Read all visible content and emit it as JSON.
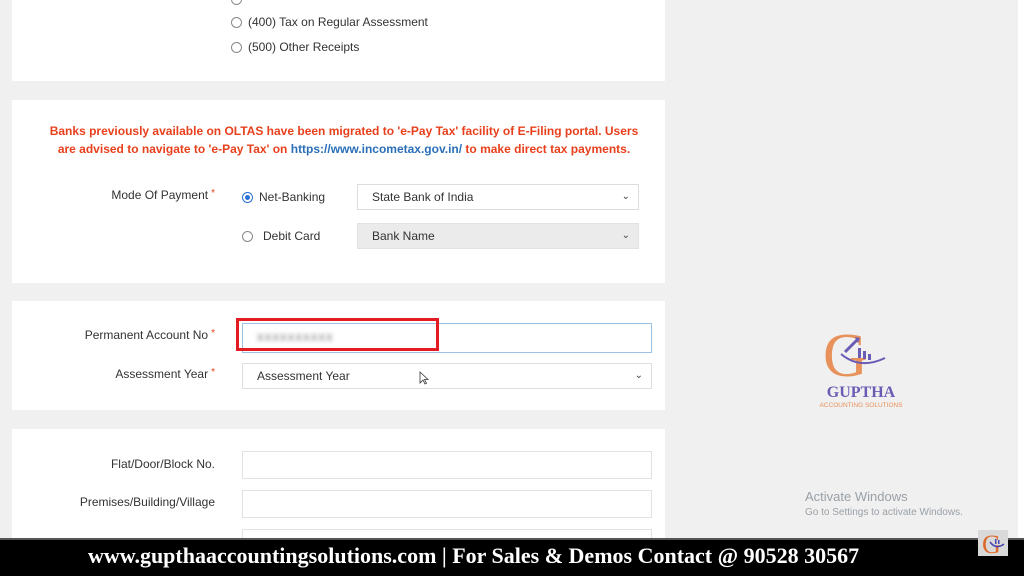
{
  "tax_type_options": [
    {
      "label": "(400) Tax on Regular Assessment",
      "selected": false
    },
    {
      "label": "(500) Other Receipts",
      "selected": false
    }
  ],
  "notice": {
    "text_before": "Banks previously available on OLTAS have been migrated to 'e-Pay Tax' facility of E-Filing portal. Users are advised to navigate to 'e-Pay Tax' on ",
    "link": "https://www.incometax.gov.in/",
    "text_after": " to make direct tax payments."
  },
  "payment": {
    "label": "Mode Of Payment",
    "required_mark": "*",
    "options": [
      {
        "label": "Net-Banking",
        "selected": true,
        "bank_value": "State Bank of India"
      },
      {
        "label": "Debit Card",
        "selected": false,
        "bank_value": "Bank Name"
      }
    ]
  },
  "identity": {
    "pan_label": "Permanent Account No",
    "pan_value": "XXXXXXXXXX",
    "assessment_year_label": "Assessment Year",
    "assessment_year_value": "Assessment Year",
    "required_mark": "*"
  },
  "address": {
    "flat_label": "Flat/Door/Block No.",
    "flat_value": "",
    "premises_label": "Premises/Building/Village",
    "premises_value": ""
  },
  "watermark": {
    "brand": "GUPTHA",
    "tagline": "ACCOUNTING SOLUTIONS",
    "activate_title": "Activate Windows",
    "activate_sub": "Go to Settings to activate Windows."
  },
  "footer": {
    "text": "www.gupthaaccountingsolutions.com | For Sales & Demos Contact @ 90528 30567"
  },
  "colors": {
    "required": "#e8401c",
    "link": "#2a6fb8",
    "highlight": "#e31b23",
    "radio_selected": "#2a6fd6"
  }
}
